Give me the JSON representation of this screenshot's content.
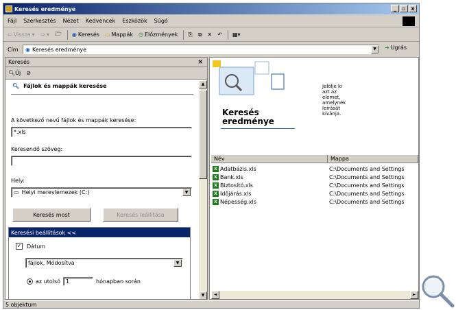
{
  "window": {
    "title": "Keresés eredménye",
    "min": "_",
    "max": "ő",
    "close": "x"
  },
  "menu": [
    "Fájl",
    "Szerkesztés",
    "Nézet",
    "Kedvencek",
    "Eszközök",
    "Súgó"
  ],
  "toolbar": {
    "back": "Vissza",
    "search": "Keresés",
    "folders": "Mappák",
    "history": "Előzmények"
  },
  "address": {
    "label": "Cím",
    "value": "Keresés eredménye",
    "go": "Ugrás"
  },
  "search_pane": {
    "title": "Keresés",
    "new": "Új",
    "heading": "Fájlok és mappák keresése",
    "name_label": "A következő nevű fájlok és mappák keresése:",
    "name_value": "*.xls",
    "text_label": "Keresendő szöveg:",
    "text_value": "",
    "location_label": "Hely:",
    "location_value": "Helyi merevlemezek (C:)",
    "search_now": "Keresés most",
    "stop_search": "Keresés leállítása",
    "options_header": "Keresési beállítások <<",
    "date_label": "Dátum",
    "date_type": "fájlok, Módosítva",
    "last_label": "az utolsó",
    "last_value": "1",
    "months_label": "hónapban során"
  },
  "banner": {
    "title_line1": "Keresés",
    "title_line2": "eredménye",
    "hint": [
      "Jelölje ki",
      "azt az",
      "elemet,",
      "amelynek",
      "leírását",
      "kívánja."
    ]
  },
  "columns": {
    "name": "Név",
    "folder": "Mappa"
  },
  "files": [
    {
      "name": "Adatbázis.xls",
      "folder": "C:\\Documents and Settings"
    },
    {
      "name": "Bank.xls",
      "folder": "C:\\Documents and Settings"
    },
    {
      "name": "Biztosító.xls",
      "folder": "C:\\Documents and Settings"
    },
    {
      "name": "Időjárás.xls",
      "folder": "C:\\Documents and Settings"
    },
    {
      "name": "Népesség.xls",
      "folder": "C:\\Documents and Settings"
    }
  ],
  "status": {
    "text": "5 objektum"
  }
}
